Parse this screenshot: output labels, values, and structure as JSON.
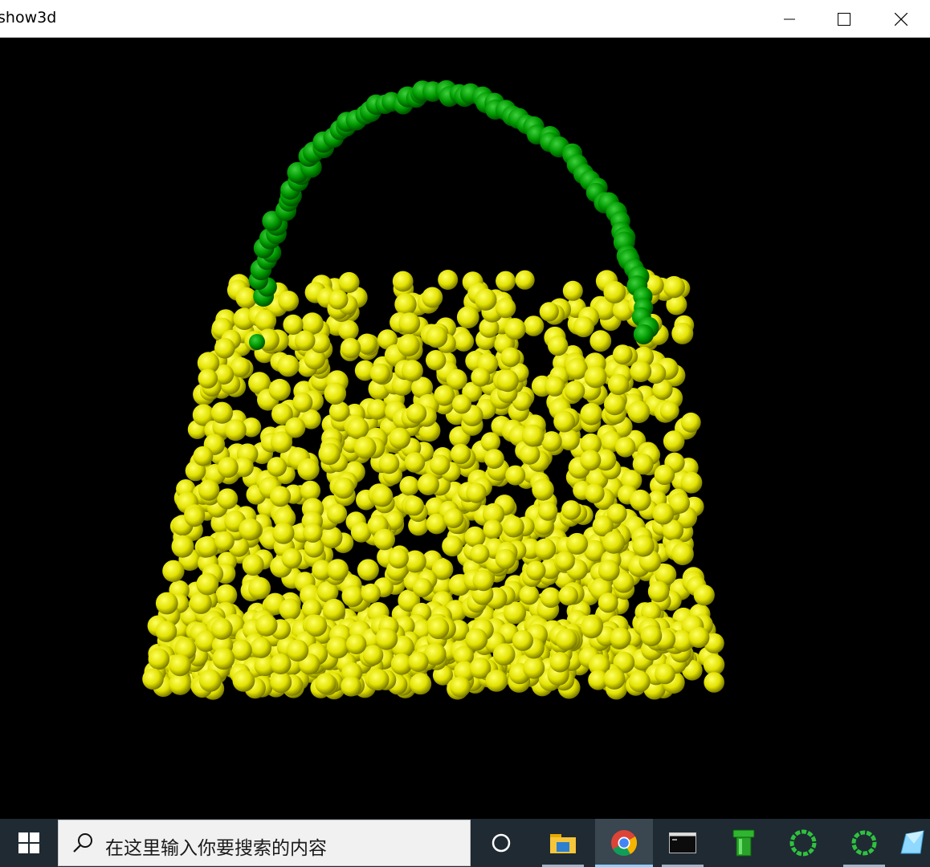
{
  "window": {
    "title": "show3d",
    "controls": {
      "minimize": "minimize",
      "maximize": "maximize",
      "close": "close"
    }
  },
  "scene": {
    "background": "#000000",
    "body_color": "#e6e600",
    "handle_color": "#00a000",
    "object": "handbag point cloud"
  },
  "taskbar": {
    "background": "#1f2a33",
    "search_placeholder": "在这里输入你要搜索的内容",
    "apps": [
      {
        "name": "task-view",
        "icon": "circle-icon"
      },
      {
        "name": "file-explorer",
        "icon": "folder-icon"
      },
      {
        "name": "chrome",
        "icon": "chrome-icon",
        "active": true
      },
      {
        "name": "terminal",
        "icon": "terminal-icon"
      },
      {
        "name": "green-pipe-app",
        "icon": "pipe-icon"
      },
      {
        "name": "green-ring-app-1",
        "icon": "ring-icon"
      },
      {
        "name": "green-ring-app-2",
        "icon": "ring-icon"
      },
      {
        "name": "crystal-app",
        "icon": "crystal-icon"
      }
    ]
  }
}
